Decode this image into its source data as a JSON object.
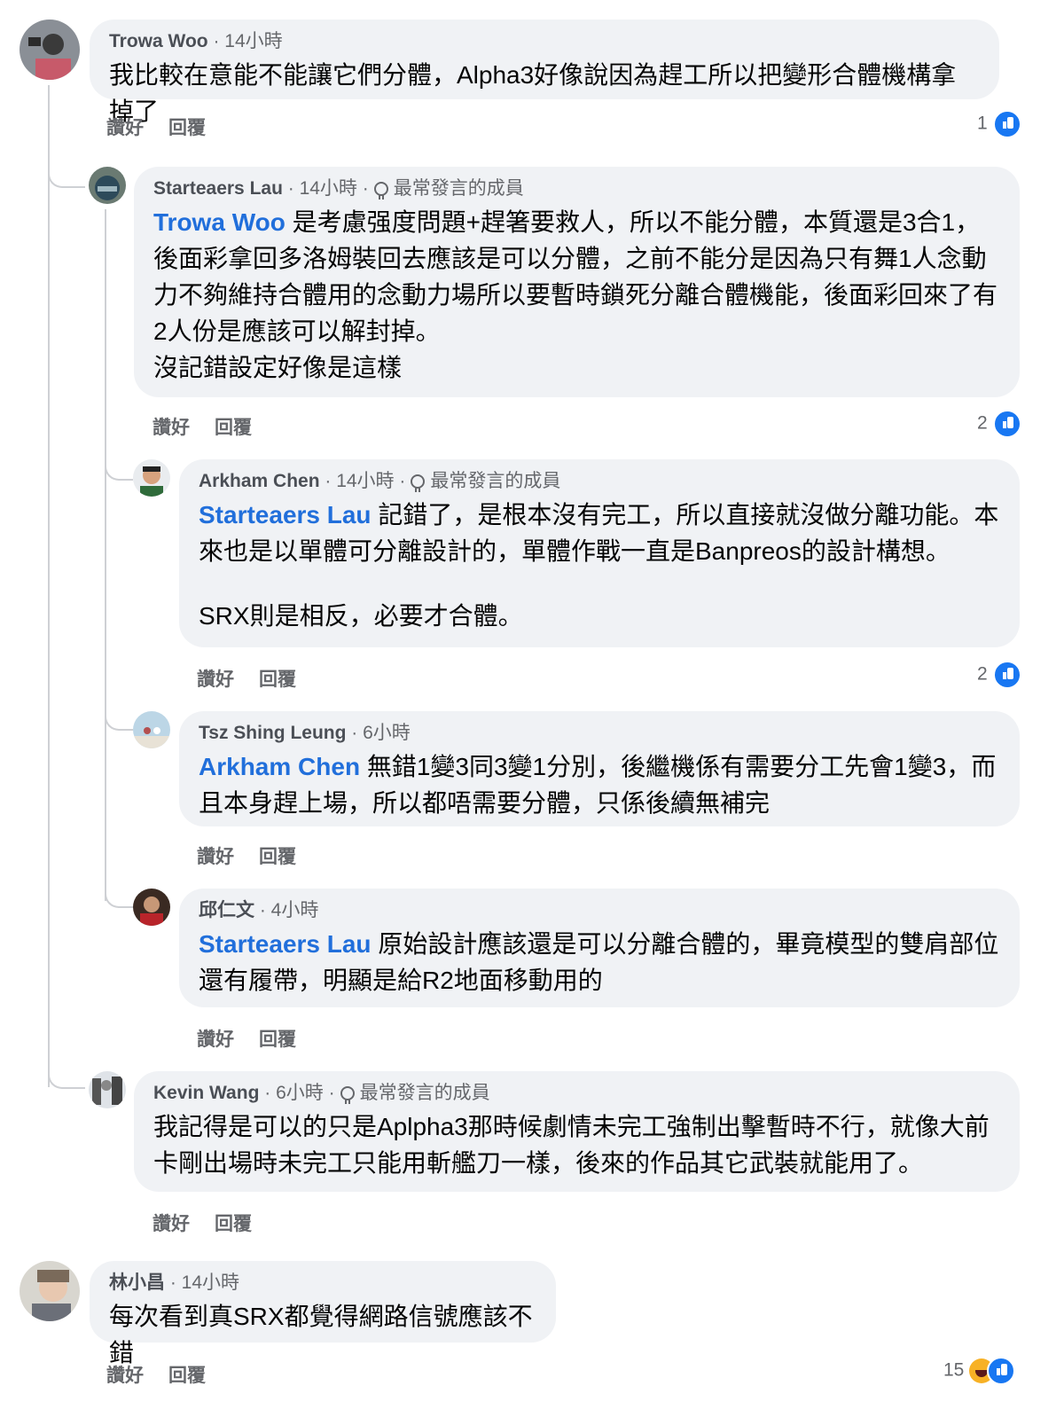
{
  "comments": [
    {
      "name": "Trowa Woo",
      "time": "· 14小時",
      "badge": "",
      "mention": "",
      "text": "我比較在意能不能讓它們分體，Alpha3好像說因為趕工所以把變形合體機構拿掉了",
      "like": "讚好",
      "reply": "回覆",
      "count": "1"
    },
    {
      "name": "Starteaers Lau",
      "time": "· 14小時 ·",
      "badge": "最常發言的成員",
      "mention": "Trowa Woo",
      "text": " 是考慮强度問題+趕箸要救人，所以不能分體，本質還是3合1，後面彩拿回多洛姆裝回去應該是可以分體，之前不能分是因為只有舞1人念動力不夠維持合體用的念動力場所以要暫時鎖死分離合體機能，後面彩回來了有2人份是應該可以解封掉。",
      "text2": "沒記錯設定好像是這樣",
      "like": "讚好",
      "reply": "回覆",
      "count": "2"
    },
    {
      "name": "Arkham Chen",
      "time": "· 14小時 ·",
      "badge": "最常發言的成員",
      "mention": "Starteaers Lau",
      "text": " 記錯了，是根本沒有完工，所以直接就沒做分離功能。本來也是以單體可分離設計的，單體作戰一直是Banpreos的設計構想。",
      "text2": "SRX則是相反，必要才合體。",
      "like": "讚好",
      "reply": "回覆",
      "count": "2"
    },
    {
      "name": "Tsz Shing Leung",
      "time": "· 6小時",
      "badge": "",
      "mention": "Arkham Chen",
      "text": " 無錯1變3同3變1分別，後繼機係有需要分工先會1變3，而且本身趕上場，所以都唔需要分體，只係後續無補完",
      "like": "讚好",
      "reply": "回覆",
      "count": ""
    },
    {
      "name": "邱仁文",
      "time": "· 4小時",
      "badge": "",
      "mention": "Starteaers Lau",
      "text": " 原始設計應該還是可以分離合體的，畢竟模型的雙肩部位還有履帶，明顯是給R2地面移動用的",
      "like": "讚好",
      "reply": "回覆",
      "count": ""
    },
    {
      "name": "Kevin Wang",
      "time": "· 6小時 ·",
      "badge": "最常發言的成員",
      "mention": "",
      "text": "我記得是可以的只是Aplpha3那時候劇情未完工強制出擊暫時不行，就像大前卡剛出場時未完工只能用斬艦刀一樣，後來的作品其它武裝就能用了。",
      "like": "讚好",
      "reply": "回覆",
      "count": ""
    },
    {
      "name": "林小昌",
      "time": "· 14小時",
      "badge": "",
      "mention": "",
      "text": "每次看到真SRX都覺得網路信號應該不錯",
      "like": "讚好",
      "reply": "回覆",
      "count": "15"
    }
  ],
  "icons": {
    "like": "like-icon",
    "haha": "haha-icon",
    "badge": "top-contributor-icon"
  },
  "colors": {
    "bubble": "#f0f2f5",
    "mention": "#216fdb",
    "like_blue": "#1877f2"
  }
}
